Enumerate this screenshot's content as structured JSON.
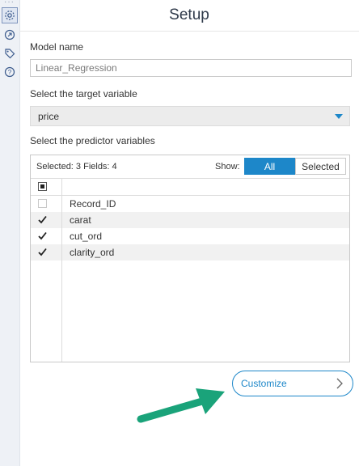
{
  "panel": {
    "title": "Setup",
    "rail_icons": [
      "gear-icon",
      "arrow-circle-icon",
      "tag-icon",
      "help-icon"
    ]
  },
  "model": {
    "label": "Model name",
    "value": "Linear_Regression"
  },
  "target": {
    "label": "Select the target variable",
    "selected": "price"
  },
  "predictors": {
    "label": "Select the predictor variables",
    "summary": "Selected: 3 Fields: 4",
    "show_label": "Show:",
    "show_all": "All",
    "show_selected": "Selected",
    "rows": [
      {
        "name": "Record_ID",
        "checked": false
      },
      {
        "name": "carat",
        "checked": true
      },
      {
        "name": "cut_ord",
        "checked": true
      },
      {
        "name": "clarity_ord",
        "checked": true
      }
    ]
  },
  "actions": {
    "customize": "Customize"
  },
  "colors": {
    "accent": "#1d87c9",
    "annotation_arrow": "#1aa37a"
  }
}
